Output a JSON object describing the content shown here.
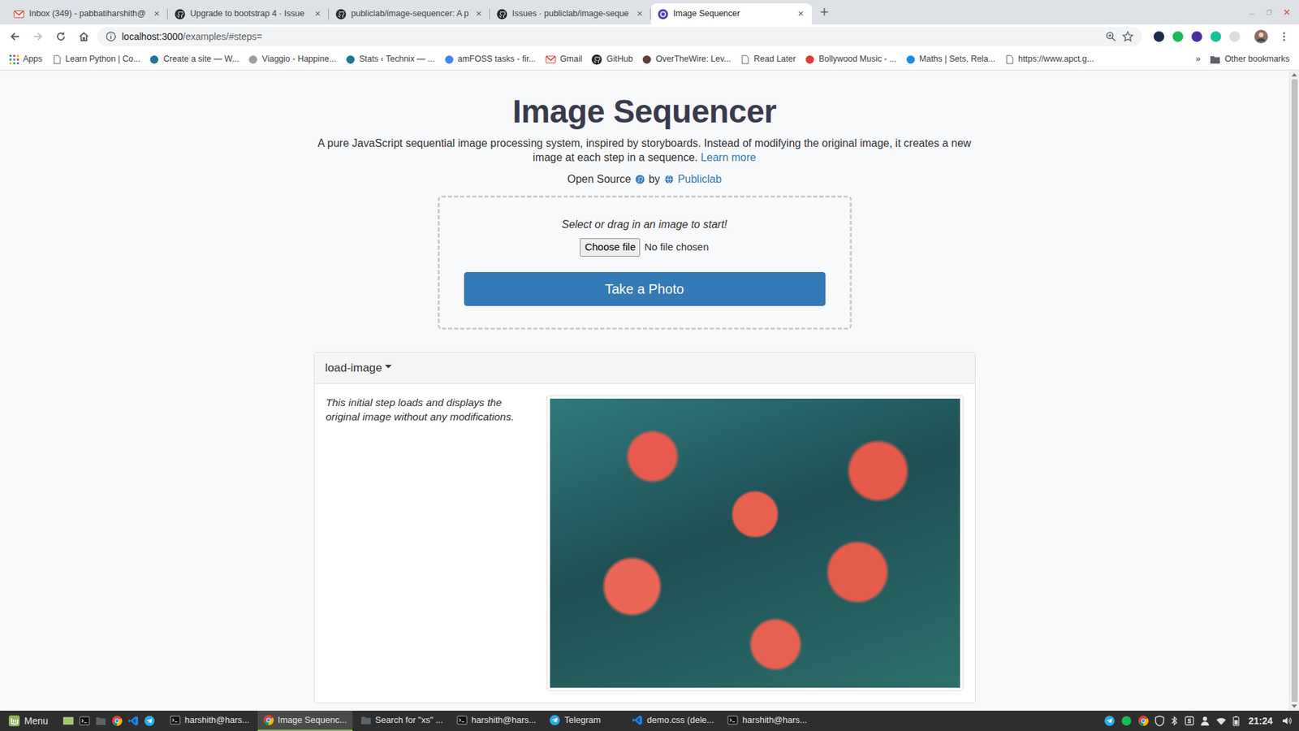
{
  "browser": {
    "tabs": [
      {
        "label": "Inbox (349) - pabbatiharshith@",
        "selected": false
      },
      {
        "label": "Upgrade to bootstrap 4 · Issue",
        "selected": false
      },
      {
        "label": "publiclab/image-sequencer: A p",
        "selected": false
      },
      {
        "label": "Issues · publiclab/image-seque",
        "selected": false
      },
      {
        "label": "Image Sequencer",
        "selected": true
      }
    ],
    "tab_close": "×",
    "new_tab": "+",
    "url_host": "localhost:3000",
    "url_path": "/examples/#steps="
  },
  "bookmarks": {
    "items": [
      "Apps",
      "Learn Python | Co...",
      "Create a site — W...",
      "Viaggio - Happine...",
      "Stats ‹ Technix — ...",
      "amFOSS tasks - fir...",
      "Gmail",
      "GitHub",
      "OverTheWire: Lev...",
      "Read Later",
      "Bollywood Music - ...",
      "Maths | Sets, Rela...",
      "https://www.apct.g..."
    ],
    "more": "»",
    "other": "Other bookmarks"
  },
  "page": {
    "title": "Image Sequencer",
    "description": "A pure JavaScript sequential image processing system, inspired by storyboards. Instead of modifying the original image, it creates a new image at each step in a sequence.",
    "learn_more": "Learn more",
    "open_source": "Open Source",
    "by": "by",
    "publiclab": "Publiclab",
    "dropzone": {
      "prompt": "Select or drag in an image to start!",
      "choose_file": "Choose file",
      "no_file": "No file chosen",
      "take_photo": "Take a Photo"
    },
    "steps": [
      {
        "name": "load-image",
        "description": "This initial step loads and displays the original image without any modifications."
      }
    ]
  },
  "taskbar": {
    "menu": "Menu",
    "windows": [
      {
        "label": "harshith@hars...",
        "selected": false
      },
      {
        "label": "Image Sequenc...",
        "selected": true
      },
      {
        "label": "Search for \"xs\" ...",
        "selected": false
      },
      {
        "label": "harshith@hars...",
        "selected": false
      },
      {
        "label": "Telegram",
        "selected": false
      },
      {
        "label": "demo.css (dele...",
        "selected": false
      },
      {
        "label": "harshith@hars...",
        "selected": false
      }
    ],
    "clock": "21:24"
  }
}
